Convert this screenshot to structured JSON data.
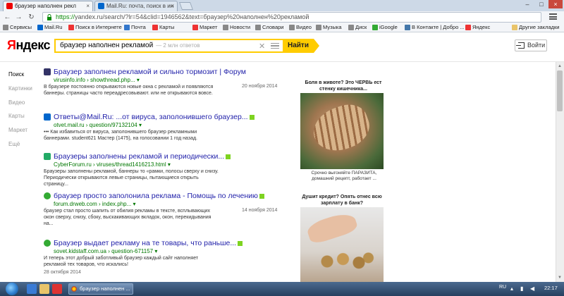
{
  "browser": {
    "tabs": [
      {
        "label": "браузер наполнен рекл",
        "favicon_color": "#e00"
      },
      {
        "label": "Mail.Ru: почта, поиск в ин",
        "favicon_color": "#06c"
      }
    ],
    "address": {
      "https": "https://",
      "rest": "yandex.ru/search/?lr=54&clid=1946562&text=браузер%20наполнен%20рекламой"
    },
    "bookmarks": [
      {
        "label": "Сервисы",
        "color": "#888"
      },
      {
        "label": "Mail.Ru",
        "color": "#06c"
      },
      {
        "label": "Поиск в Интернете",
        "color": "#e33"
      },
      {
        "label": "Почта",
        "color": "#37c"
      },
      {
        "label": "Карты",
        "color": "#e33"
      },
      {
        "label": "Маркет",
        "color": "#e33"
      },
      {
        "label": "Новости",
        "color": "#888"
      },
      {
        "label": "Словари",
        "color": "#888"
      },
      {
        "label": "Видео",
        "color": "#888"
      },
      {
        "label": "Музыка",
        "color": "#888"
      },
      {
        "label": "Диск",
        "color": "#888"
      },
      {
        "label": "iGoogle",
        "color": "#3a3"
      },
      {
        "label": "В Контакте | Добро ...",
        "color": "#47a"
      },
      {
        "label": "Яндекс",
        "color": "#e33"
      },
      {
        "label": "Другие закладки",
        "color": "#e9c46a"
      }
    ]
  },
  "header": {
    "logo_ya": "Я",
    "logo_ndex": "ндекс",
    "query": "браузер наполнен рекламой",
    "hint": "— 2 млн ответов",
    "find_label": "Найти",
    "login_label": "Войти"
  },
  "sidenav": [
    "Поиск",
    "Картинки",
    "Видео",
    "Карты",
    "Маркет",
    "Ещё"
  ],
  "results": [
    {
      "favicon_color": "#336",
      "title_bold": "Браузер заполнен рекламой",
      "title_rest": " и сильно тормозит | Форум",
      "url": "virusinfo.info › showthread.php... ▾",
      "snippet": "В браузере постоянно открываются новые окна с рекламой и появляются баннеры. страницы часто переадресовывают. или не открываются вовсе.",
      "date": "20 ноября 2014"
    },
    {
      "favicon_color": "#06c",
      "title_bold": "Ответы@Mail.Ru",
      "title_rest": ": ...от вируса, заполонившего браузер...",
      "url": "otvet.mail.ru › question/97132104 ▾",
      "snippet": "••• Как избавиться от вируса, заполонившего браузер рекламными баннерами. student621 Мастер (1475), на голосовании 1 год назад.",
      "date": ""
    },
    {
      "favicon_color": "#2a6",
      "title_bold": "Браузеры заполнены рекламой",
      "title_rest": " и периодически...",
      "url": "CyberForum.ru › viruses/thread1416213.html ▾",
      "snippet": "Браузеры заполнены рекламой, баннеры то «рамки, полосы сверху и снизу. Периодически открываются левые страницы, пытающиеся открыть страницу...",
      "date": ""
    },
    {
      "favicon_color": "#3a3",
      "title_bold": "браузер",
      "title_rest": " просто заполонила реклама - Помощь по лечению",
      "url": "forum.drweb.com › index.php... ▾",
      "snippet": "браузер стал просто шапить от обилия рекламы в тексте, всплывающих окон сверху, снизу, сбоку, выскакивающих вкладок, окон, перекидывания на...",
      "date": "14 ноября 2014"
    },
    {
      "favicon_color": "#3a3",
      "title_bold": "Браузер выдает рекламу",
      "title_rest": " на те товары, что раньше...",
      "url": "sovet.kidstaff.com.ua › question-671157 ▾",
      "snippet": "И теперь этот добрый заботливый браузер каждый сайт наполняет рекламой тех товаров, что искались!",
      "date": "28 октября 2014"
    }
  ],
  "ads": [
    {
      "title": "Боля в животе? Это ЧЕРВЬ ест стенку кишечника...",
      "caption": "Срочно выгоняйте ПАРАЗИТА, домашний рецепт, работает ..."
    },
    {
      "title": "Душит кредит? Опять отнес всю зарплату в банк?",
      "caption": ""
    }
  ],
  "taskbar": {
    "task_label": "браузер наполнен ...",
    "lang": "RU",
    "time": "22:17"
  }
}
